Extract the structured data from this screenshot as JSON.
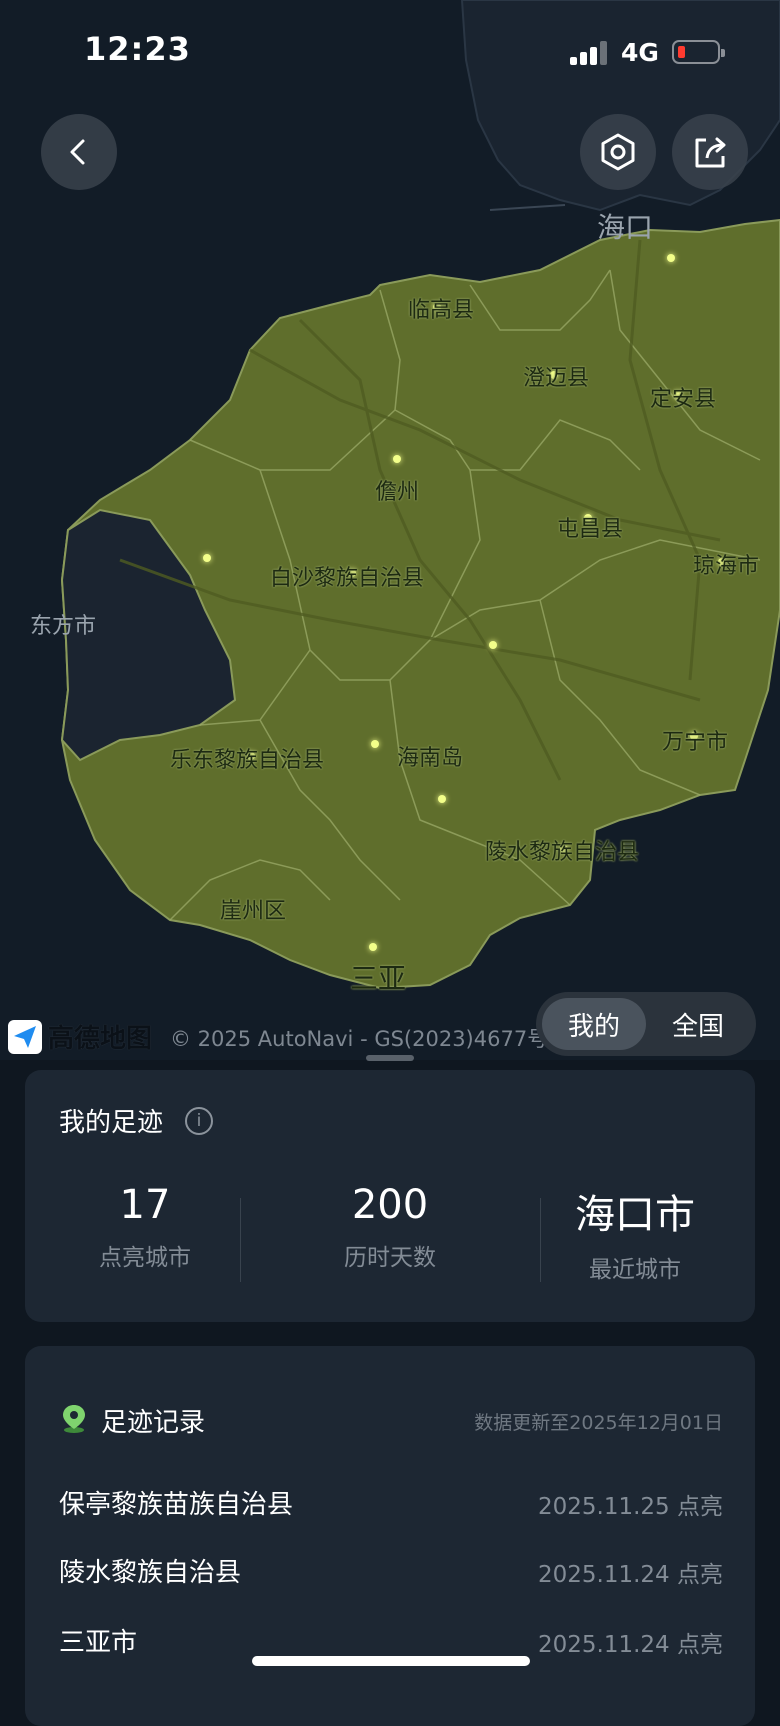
{
  "status_bar": {
    "time": "12:23",
    "network": "4G",
    "battery_low": true
  },
  "map": {
    "labels": {
      "haikou": "海口",
      "lingao": "临高县",
      "chengmai": "澄迈县",
      "ding_an": "定安县",
      "danzhou": "儋州",
      "tunchang": "屯昌县",
      "qionghai": "琼海市",
      "baisha": "白沙黎族自治县",
      "dongfang": "东方市",
      "ledong": "乐东黎族自治县",
      "hainan_island": "海南岛",
      "wanning": "万宁市",
      "lingshui": "陵水黎族自治县",
      "yazhou": "崖州区",
      "sanya": "三亚"
    },
    "land_color": "#5f6e2c",
    "dot_color": "#f3ff8a",
    "brand": "高德地图",
    "copyright": "© 2025 AutoNavi - GS(2023)4677号"
  },
  "toggle": {
    "mine": "我的",
    "national": "全国"
  },
  "summary": {
    "title": "我的足迹",
    "stats": [
      {
        "value": "17",
        "label": "点亮城市"
      },
      {
        "value": "200",
        "label": "历时天数"
      },
      {
        "value": "海口市",
        "label": "最近城市"
      }
    ]
  },
  "records": {
    "title": "足迹记录",
    "updated": "数据更新至2025年12月01日",
    "items": [
      {
        "name": "保亭黎族苗族自治县",
        "date": "2025.11.25 点亮"
      },
      {
        "name": "陵水黎族自治县",
        "date": "2025.11.24 点亮"
      },
      {
        "name": "三亚市",
        "date": "2025.11.24 点亮"
      }
    ]
  }
}
